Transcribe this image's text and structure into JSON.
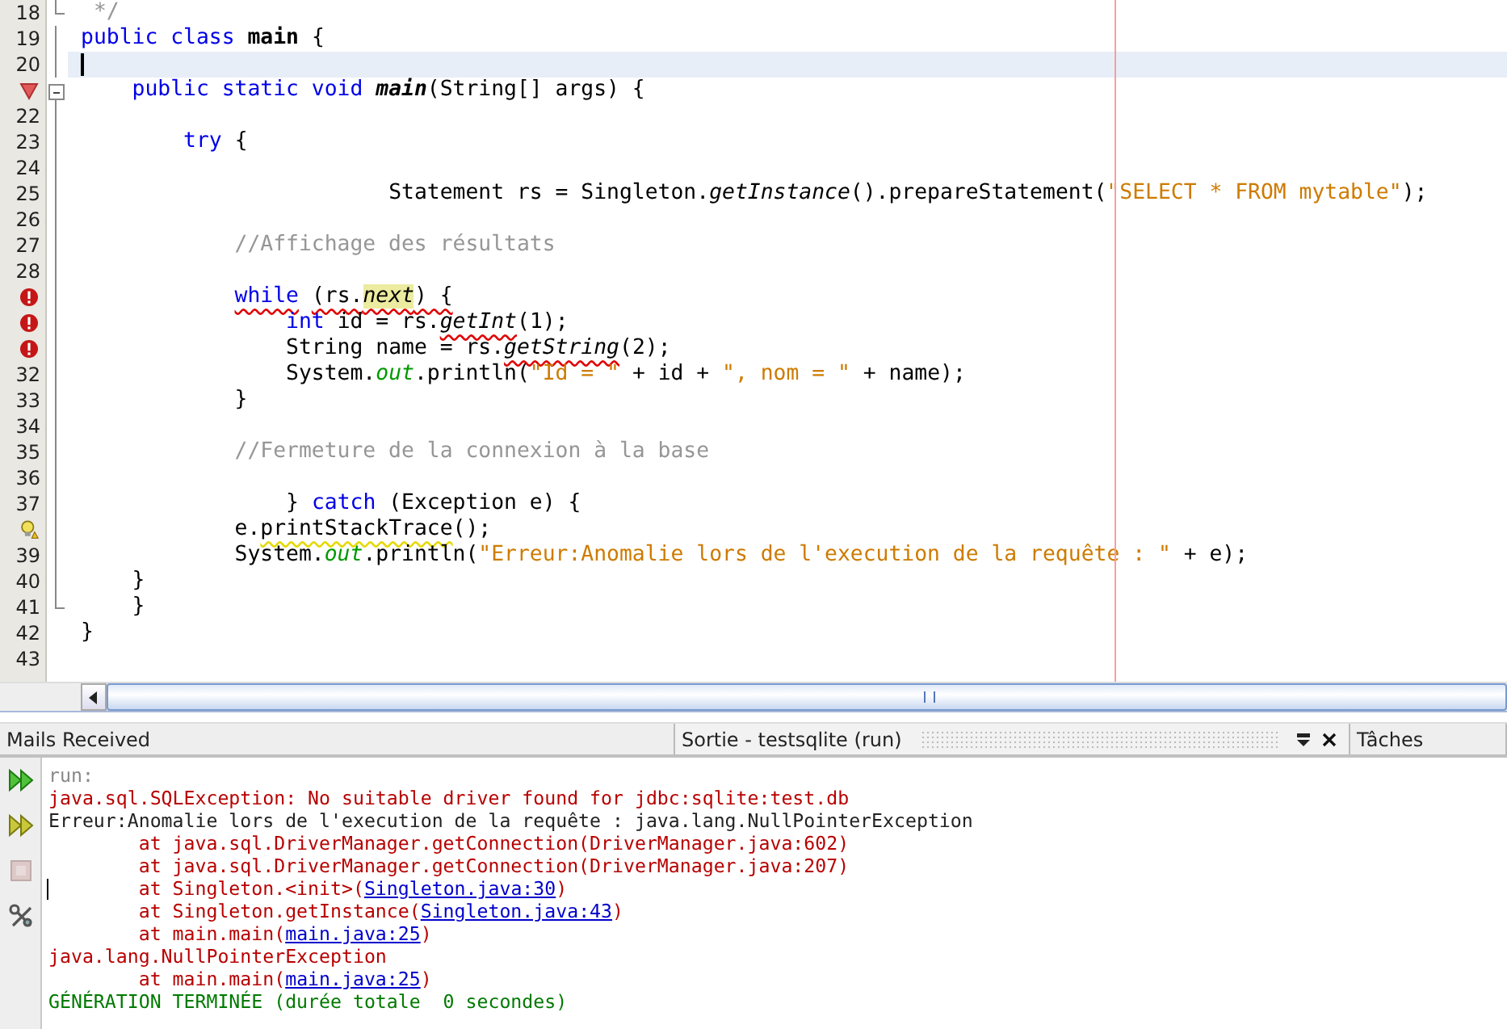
{
  "editor": {
    "lines": [
      {
        "kind": "number",
        "number": "18",
        "fold_end": true,
        "tokens": [
          {
            "t": " */",
            "kind": "comment"
          }
        ]
      },
      {
        "kind": "number",
        "number": "19",
        "in_fold": true,
        "tokens": [
          {
            "t": "public class ",
            "kind": "kw"
          },
          {
            "t": "main",
            "kind": "class"
          },
          {
            "t": " {",
            "kind": "plain"
          }
        ]
      },
      {
        "kind": "number",
        "number": "20",
        "in_fold": true,
        "current": true
      },
      {
        "kind": "breakpoint",
        "fold_start": true,
        "tokens": [
          {
            "t": "    public static void ",
            "kind": "kw"
          },
          {
            "t": "main",
            "kind": "decl"
          },
          {
            "t": "(String[] args) {",
            "kind": "plain"
          }
        ]
      },
      {
        "kind": "number",
        "number": "22",
        "in_fold": true
      },
      {
        "kind": "number",
        "number": "23",
        "in_fold": true,
        "tokens": [
          {
            "t": "        try",
            "kind": "kw"
          },
          {
            "t": " {",
            "kind": "plain"
          }
        ]
      },
      {
        "kind": "number",
        "number": "24",
        "in_fold": true
      },
      {
        "kind": "number",
        "number": "25",
        "in_fold": true,
        "tokens": [
          {
            "t": "                        Statement rs = Singleton.",
            "kind": "plain"
          },
          {
            "t": "getInstance",
            "kind": "call"
          },
          {
            "t": "().prepareStatement(",
            "kind": "plain"
          },
          {
            "t": "\"SELECT * FROM mytable\"",
            "kind": "string"
          },
          {
            "t": ");",
            "kind": "plain"
          }
        ]
      },
      {
        "kind": "number",
        "number": "26",
        "in_fold": true
      },
      {
        "kind": "number",
        "number": "27",
        "in_fold": true,
        "tokens": [
          {
            "t": "            //Affichage des résultats",
            "kind": "comment"
          }
        ]
      },
      {
        "kind": "number",
        "number": "28",
        "in_fold": true
      },
      {
        "kind": "error",
        "in_fold": true,
        "tokens": [
          {
            "t": "            while",
            "kind": "kw",
            "err": true
          },
          {
            "t": " (rs.",
            "kind": "plain",
            "err": true
          },
          {
            "t": "next",
            "kind": "call",
            "err": true,
            "hl": true
          },
          {
            "t": ") {",
            "kind": "plain",
            "err": true
          }
        ]
      },
      {
        "kind": "error",
        "in_fold": true,
        "tokens": [
          {
            "t": "                int",
            "kind": "kw"
          },
          {
            "t": " id = rs.",
            "kind": "plain"
          },
          {
            "t": "getInt",
            "kind": "call",
            "err": true
          },
          {
            "t": "(1);",
            "kind": "plain"
          }
        ]
      },
      {
        "kind": "error",
        "in_fold": true,
        "tokens": [
          {
            "t": "                String name = rs.",
            "kind": "plain"
          },
          {
            "t": "getString",
            "kind": "call",
            "err": true
          },
          {
            "t": "(2);",
            "kind": "plain"
          }
        ]
      },
      {
        "kind": "number",
        "number": "32",
        "in_fold": true,
        "tokens": [
          {
            "t": "                System.",
            "kind": "plain"
          },
          {
            "t": "out",
            "kind": "field"
          },
          {
            "t": ".println(",
            "kind": "plain"
          },
          {
            "t": "\"Id = \"",
            "kind": "string"
          },
          {
            "t": " + id + ",
            "kind": "plain"
          },
          {
            "t": "\", nom = \"",
            "kind": "string"
          },
          {
            "t": " + name);",
            "kind": "plain"
          }
        ]
      },
      {
        "kind": "number",
        "number": "33",
        "in_fold": true,
        "tokens": [
          {
            "t": "            }",
            "kind": "plain"
          }
        ]
      },
      {
        "kind": "number",
        "number": "34",
        "in_fold": true
      },
      {
        "kind": "number",
        "number": "35",
        "in_fold": true,
        "tokens": [
          {
            "t": "            //Fermeture de la connexion à la base",
            "kind": "comment"
          }
        ]
      },
      {
        "kind": "number",
        "number": "36",
        "in_fold": true
      },
      {
        "kind": "number",
        "number": "37",
        "in_fold": true,
        "tokens": [
          {
            "t": "                } ",
            "kind": "plain"
          },
          {
            "t": "catch",
            "kind": "kw"
          },
          {
            "t": " (Exception e) {",
            "kind": "plain"
          }
        ]
      },
      {
        "kind": "warning",
        "in_fold": true,
        "tokens": [
          {
            "t": "            e.",
            "kind": "plain"
          },
          {
            "t": "printStackTrace",
            "kind": "plain",
            "warn": true
          },
          {
            "t": "();",
            "kind": "plain"
          }
        ]
      },
      {
        "kind": "number",
        "number": "39",
        "in_fold": true,
        "tokens": [
          {
            "t": "            System.",
            "kind": "plain"
          },
          {
            "t": "out",
            "kind": "field"
          },
          {
            "t": ".println(",
            "kind": "plain"
          },
          {
            "t": "\"Erreur:Anomalie lors de l'execution de la requête : \"",
            "kind": "string"
          },
          {
            "t": " + e);",
            "kind": "plain"
          }
        ]
      },
      {
        "kind": "number",
        "number": "40",
        "in_fold": true,
        "tokens": [
          {
            "t": "    }",
            "kind": "plain"
          }
        ]
      },
      {
        "kind": "number",
        "number": "41",
        "fold_end": true,
        "tokens": [
          {
            "t": "    }",
            "kind": "plain"
          }
        ]
      },
      {
        "kind": "number",
        "number": "42",
        "tokens": [
          {
            "t": "}",
            "kind": "plain"
          }
        ]
      },
      {
        "kind": "number",
        "number": "43"
      }
    ]
  },
  "tabs": [
    {
      "label": "Mails Received",
      "selected": false
    },
    {
      "label": "Sortie - testsqlite (run)",
      "selected": true
    },
    {
      "label": "Tâches",
      "selected": false
    }
  ],
  "output": {
    "toolbar": [
      {
        "kind": "rerun",
        "disabled": false
      },
      {
        "kind": "rerun-options",
        "disabled": false
      },
      {
        "kind": "stop",
        "disabled": true
      },
      {
        "kind": "settings",
        "disabled": false
      }
    ],
    "lines": [
      {
        "kind": "muted",
        "parts": [
          {
            "t": "run:"
          }
        ]
      },
      {
        "kind": "error",
        "parts": [
          {
            "t": "java.sql.SQLException: No suitable driver found for jdbc:sqlite:test.db"
          }
        ]
      },
      {
        "kind": "plain",
        "parts": [
          {
            "t": "Erreur:Anomalie lors de l'execution de la requête : java.lang.NullPointerException"
          }
        ]
      },
      {
        "kind": "error",
        "parts": [
          {
            "t": "        at java.sql.DriverManager.getConnection(DriverManager.java:602)"
          }
        ]
      },
      {
        "kind": "error",
        "parts": [
          {
            "t": "        at java.sql.DriverManager.getConnection(DriverManager.java:207)"
          }
        ]
      },
      {
        "kind": "error",
        "caret": true,
        "parts": [
          {
            "t": "        at Singleton.<init>("
          },
          {
            "t": "Singleton.java:30",
            "link": true
          },
          {
            "t": ")"
          }
        ]
      },
      {
        "kind": "error",
        "parts": [
          {
            "t": "        at Singleton.getInstance("
          },
          {
            "t": "Singleton.java:43",
            "link": true
          },
          {
            "t": ")"
          }
        ]
      },
      {
        "kind": "error",
        "parts": [
          {
            "t": "        at main.main("
          },
          {
            "t": "main.java:25",
            "link": true
          },
          {
            "t": ")"
          }
        ]
      },
      {
        "kind": "error",
        "parts": [
          {
            "t": "java.lang.NullPointerException"
          }
        ]
      },
      {
        "kind": "error",
        "parts": [
          {
            "t": "        at main.main("
          },
          {
            "t": "main.java:25",
            "link": true
          },
          {
            "t": ")"
          }
        ]
      },
      {
        "kind": "success",
        "parts": [
          {
            "t": "GÉNÉRATION TERMINÉE (durée totale  0 secondes)"
          }
        ]
      }
    ]
  }
}
